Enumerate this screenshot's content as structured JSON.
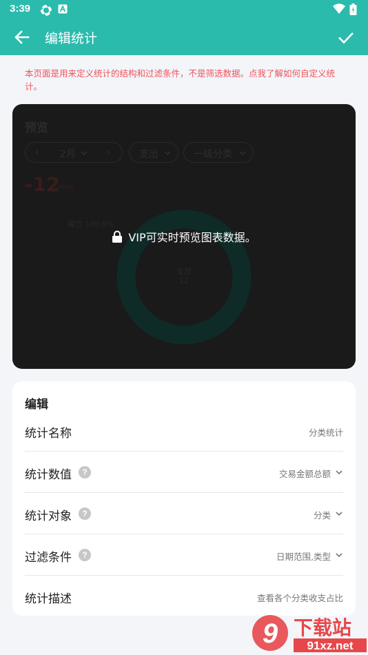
{
  "status_bar": {
    "time": "3:39",
    "icons": [
      "sync-icon",
      "a-notification-icon",
      "wifi-icon",
      "battery-icon"
    ]
  },
  "app_bar": {
    "title": "编辑统计",
    "back_icon": "arrow-back-icon",
    "confirm_icon": "check-icon",
    "color": "#2bbbad"
  },
  "notice": {
    "text": "本页面是用来定义统计的结构和过滤条件，不是筛选数据。点我了解如何自定义统计。",
    "color": "#f0535c"
  },
  "preview": {
    "title": "预览",
    "date_filter": {
      "prev": "‹",
      "value": "2月",
      "next": "›"
    },
    "type_filter": "支出",
    "category_filter": "一级分类",
    "amount": "-12",
    "amount_unit": "RMB",
    "ghost_label": "餐饮 100.0%",
    "donut_center_label": "全部",
    "donut_center_value": "12",
    "ring_color": "#0e2b28",
    "vip_message": "VIP可实时预览图表数据。",
    "lock_icon": "lock-icon"
  },
  "editor": {
    "section_title": "编辑",
    "rows": [
      {
        "label": "统计名称",
        "value": "分类统计",
        "help": false,
        "dropdown": false
      },
      {
        "label": "统计数值",
        "value": "交易金额总额",
        "help": true,
        "dropdown": true
      },
      {
        "label": "统计对象",
        "value": "分类",
        "help": true,
        "dropdown": true
      },
      {
        "label": "过滤条件",
        "value": "日期范围,类型",
        "help": true,
        "dropdown": true
      },
      {
        "label": "统计描述",
        "value": "查看各个分类收支占比",
        "help": false,
        "dropdown": false
      }
    ]
  },
  "watermark": {
    "text_top": "下载站",
    "text_bottom": "91xz.net",
    "logo_text": "9"
  }
}
